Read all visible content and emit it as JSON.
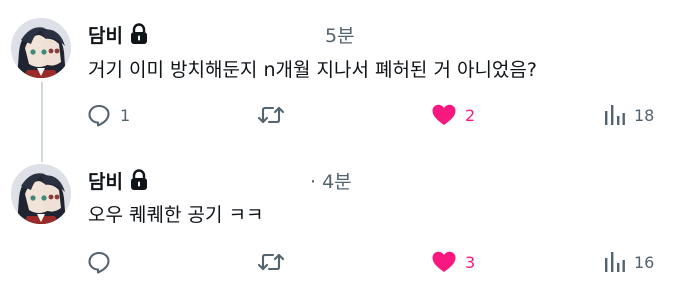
{
  "colors": {
    "like_active": "#f91880",
    "icon_muted": "#536471",
    "thread_line": "#cfd9de",
    "text_primary": "#0f1419"
  },
  "tweets": [
    {
      "author": "담비",
      "author_badge_icon": "lock-icon",
      "timestamp": "5분",
      "text": "거기 이미 방치해둔지 n개월 지나서 폐허된 거 아니었음?",
      "actions": {
        "reply_count": "1",
        "retweet_count": "",
        "like_count": "2",
        "liked": true,
        "views_count": "18"
      }
    },
    {
      "author": "담비",
      "author_badge_icon": "lock-icon",
      "timestamp": "· 4분",
      "text": "오우 퀘퀘한 공기 ㅋㅋ",
      "actions": {
        "reply_count": "",
        "retweet_count": "",
        "like_count": "3",
        "liked": true,
        "views_count": "16"
      }
    }
  ]
}
